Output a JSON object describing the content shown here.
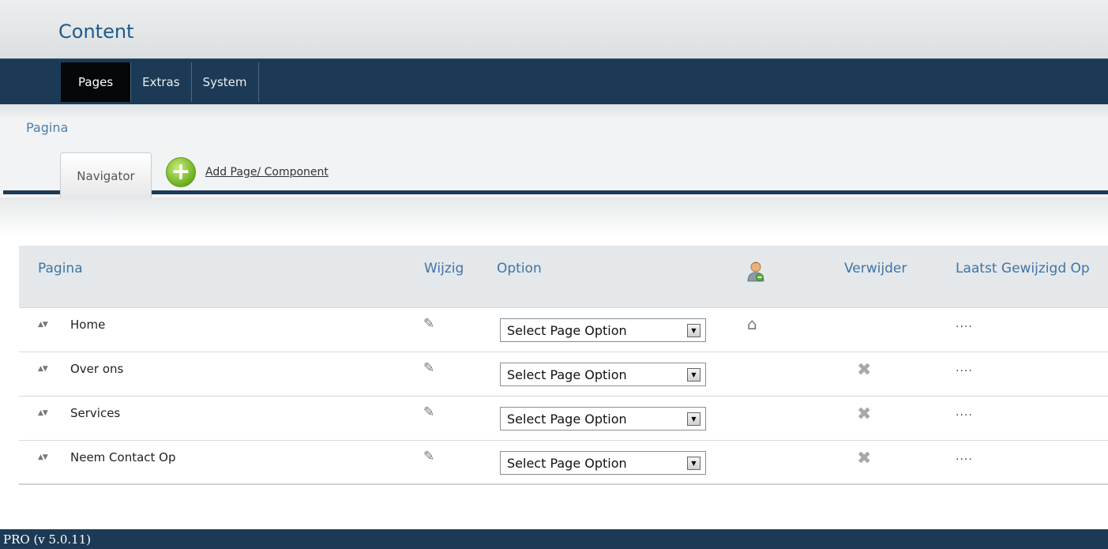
{
  "header": {
    "title": "Content"
  },
  "nav": {
    "tabs": [
      {
        "label": "Pages",
        "active": true
      },
      {
        "label": "Extras",
        "active": false
      },
      {
        "label": "System",
        "active": false
      }
    ]
  },
  "subheader": {
    "breadcrumb": "Pagina",
    "navigator_tab": "Navigator",
    "add_link": "Add Page/ Component"
  },
  "table": {
    "headers": {
      "pagina": "Pagina",
      "wijzig": "Wijzig",
      "option": "Option",
      "verwijder": "Verwijder",
      "laatst": "Laatst Gewijzigd Op"
    },
    "rows": [
      {
        "name": "Home",
        "option": "Select Page Option",
        "home": true,
        "delete": false,
        "modified": "...."
      },
      {
        "name": "Over ons",
        "option": "Select Page Option",
        "home": false,
        "delete": true,
        "modified": "...."
      },
      {
        "name": "Services",
        "option": "Select Page Option",
        "home": false,
        "delete": true,
        "modified": "...."
      },
      {
        "name": "Neem Contact Op",
        "option": "Select Page Option",
        "home": false,
        "delete": true,
        "modified": "...."
      }
    ]
  },
  "footer": {
    "version": "PRO (v 5.0.11)"
  },
  "colors": {
    "navy": "#1c3a55",
    "link_blue": "#3f74a4",
    "title_blue": "#1e5a8c"
  }
}
